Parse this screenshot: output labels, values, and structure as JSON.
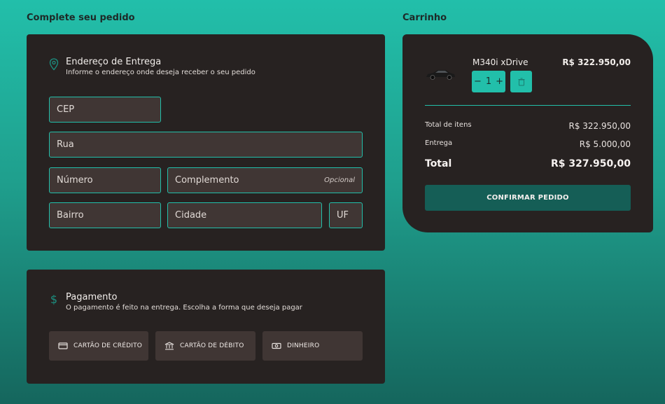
{
  "checkout": {
    "title": "Complete seu pedido",
    "address": {
      "title": "Endereço de Entrega",
      "subtitle": "Informe o endereço onde deseja receber o seu pedido",
      "fields": {
        "cep": "CEP",
        "rua": "Rua",
        "numero": "Número",
        "complemento": "Complemento",
        "complemento_hint": "Opcional",
        "bairro": "Bairro",
        "cidade": "Cidade",
        "uf": "UF"
      }
    },
    "payment": {
      "title": "Pagamento",
      "subtitle": "O pagamento é feito na entrega. Escolha a forma que deseja pagar",
      "options": [
        "CARTÃO DE CRÉDITO",
        "CARTÃO DE DÉBITO",
        "DINHEIRO"
      ]
    }
  },
  "cart": {
    "title": "Carrinho",
    "item": {
      "name": "M340i xDrive",
      "price": "R$ 322.950,00",
      "quantity": "1",
      "minus": "−",
      "plus": "+"
    },
    "summary": {
      "items_label": "Total de itens",
      "items_value": "R$ 322.950,00",
      "delivery_label": "Entrega",
      "delivery_value": "R$ 5.000,00",
      "total_label": "Total",
      "total_value": "R$ 327.950,00"
    },
    "confirm_label": "CONFIRMAR PEDIDO"
  },
  "colors": {
    "accent": "#22bfaa",
    "card": "#272221",
    "input": "#403634",
    "button_dark": "#155e56"
  },
  "icons": {
    "address": "map-pin-icon",
    "payment": "dollar-icon",
    "credit": "credit-card-icon",
    "debit": "bank-icon",
    "cash": "money-icon",
    "trash": "trash-icon"
  }
}
